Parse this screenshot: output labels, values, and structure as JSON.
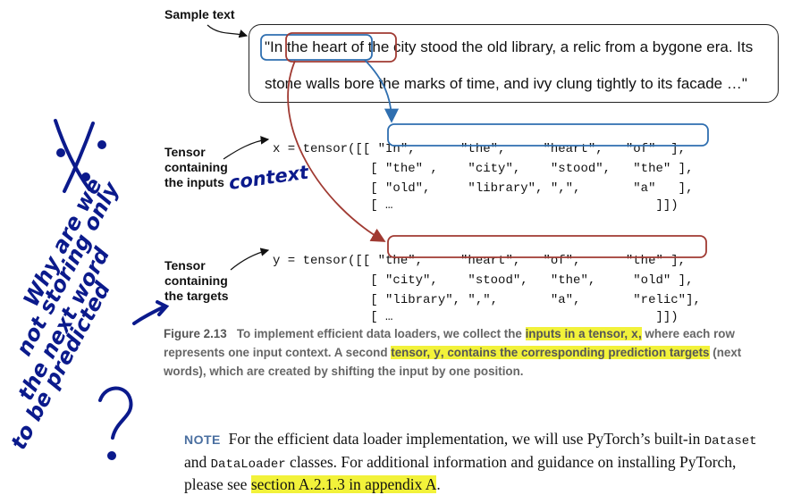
{
  "callouts": {
    "sample_text": "Sample text",
    "tensor_inputs": [
      "Tensor",
      "containing",
      "the inputs"
    ],
    "tensor_targets": [
      "Tensor",
      "containing",
      "the targets"
    ]
  },
  "sample": {
    "line1": "\"In the heart of the city stood the old library, a relic from a bygone era. Its",
    "line2": "stone walls bore the marks of time, and ivy clung tightly to its facade …\""
  },
  "x_tensor": {
    "row1": "x = tensor([[ \"In\",      \"the\",     \"heart\",   \"of\"  ],",
    "row2": "             [ \"the\" ,    \"city\",    \"stood\",   \"the\" ],",
    "row3": "             [ \"old\",     \"library\", \",\",       \"a\"   ],",
    "row4": "             [ …                                   ]])"
  },
  "y_tensor": {
    "row1": "y = tensor([[ \"the\",     \"heart\",   \"of\",      \"the\" ],",
    "row2": "             [ \"city\",    \"stood\",   \"the\",     \"old\" ],",
    "row3": "             [ \"library\", \",\",       \"a\",       \"relic\"],",
    "row4": "             [ …                                   ]])"
  },
  "caption": {
    "fig": "Figure 2.13",
    "t1": "To implement efficient data loaders, we collect the",
    "h1a": "inputs in a tensor,",
    "h1code": "x",
    "h1b": ",",
    "t2": "where each row represents one input context. A second",
    "h2a": "tensor,",
    "h2code": "y",
    "h2b": ", contains the corresponding prediction targets",
    "t3": "(next words), which are created by shifting the input by one position."
  },
  "note": {
    "label": "NOTE",
    "t1": "For the efficient data loader implementation, we will use PyTorch’s built-in",
    "c1": "Dataset",
    "t2": "and",
    "c2": "DataLoader",
    "t3": "classes. For additional information and guidance on installing PyTorch, please see",
    "h": "section A.2.1.3 in appendix A",
    "t4": "."
  },
  "handwriting": {
    "context": "context",
    "question": "Why are we not storing only the next word to be predicted?"
  },
  "colors": {
    "blue_box": "#2f6fb0",
    "red_box": "#a03a32",
    "highlight": "#f2f23a",
    "ink": "#0b1a8c"
  }
}
